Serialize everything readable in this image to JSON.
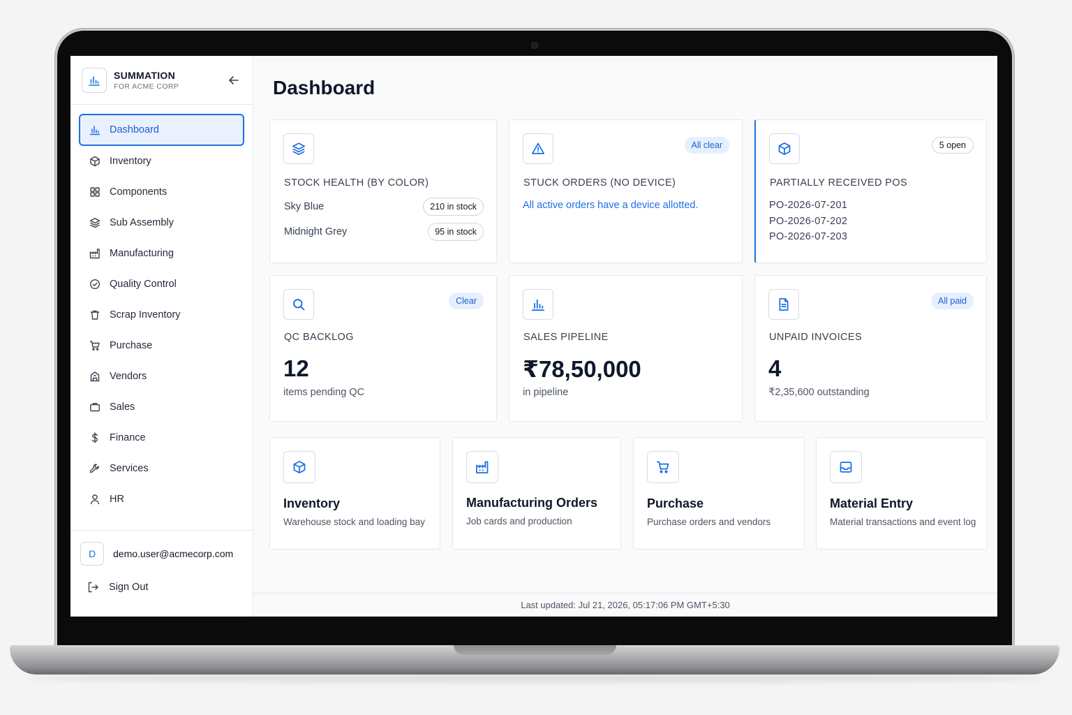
{
  "brand": {
    "name": "SUMMATION",
    "subtitle": "FOR ACME CORP"
  },
  "page_title": "Dashboard",
  "nav": [
    {
      "label": "Dashboard",
      "icon": "chart-icon",
      "active": true
    },
    {
      "label": "Inventory",
      "icon": "cube-icon"
    },
    {
      "label": "Components",
      "icon": "grid-icon"
    },
    {
      "label": "Sub Assembly",
      "icon": "layers-icon"
    },
    {
      "label": "Manufacturing",
      "icon": "factory-icon"
    },
    {
      "label": "Quality Control",
      "icon": "check-circle-icon"
    },
    {
      "label": "Scrap Inventory",
      "icon": "trash-icon"
    },
    {
      "label": "Purchase",
      "icon": "cart-icon"
    },
    {
      "label": "Vendors",
      "icon": "building-icon"
    },
    {
      "label": "Sales",
      "icon": "briefcase-icon"
    },
    {
      "label": "Finance",
      "icon": "dollar-icon"
    },
    {
      "label": "Services",
      "icon": "wrench-icon"
    },
    {
      "label": "HR",
      "icon": "user-icon"
    }
  ],
  "user": {
    "initial": "D",
    "email": "demo.user@acmecorp.com",
    "signout_label": "Sign Out"
  },
  "cards": {
    "stock_health": {
      "label": "STOCK HEALTH (BY COLOR)",
      "rows": [
        {
          "name": "Sky Blue",
          "stock": "210 in stock"
        },
        {
          "name": "Midnight Grey",
          "stock": "95 in stock"
        }
      ]
    },
    "stuck_orders": {
      "label": "STUCK ORDERS (NO DEVICE)",
      "badge": "All clear",
      "message": "All active orders have a device allotted."
    },
    "partial_pos": {
      "label": "PARTIALLY RECEIVED POS",
      "badge": "5 open",
      "items": [
        "PO-2026-07-201",
        "PO-2026-07-202",
        "PO-2026-07-203"
      ]
    },
    "qc_backlog": {
      "label": "QC BACKLOG",
      "badge": "Clear",
      "value": "12",
      "sub": "items pending QC"
    },
    "sales_pipeline": {
      "label": "SALES PIPELINE",
      "value": "₹78,50,000",
      "sub": "in pipeline"
    },
    "unpaid_invoices": {
      "label": "UNPAID INVOICES",
      "badge": "All paid",
      "value": "4",
      "sub": "₹2,35,600 outstanding"
    }
  },
  "quick_links": [
    {
      "title": "Inventory",
      "desc": "Warehouse stock and loading bay",
      "icon": "cube-icon"
    },
    {
      "title": "Manufacturing Orders",
      "desc": "Job cards and production",
      "icon": "factory-icon"
    },
    {
      "title": "Purchase",
      "desc": "Purchase orders and vendors",
      "icon": "cart-icon"
    },
    {
      "title": "Material Entry",
      "desc": "Material transactions and event log",
      "icon": "inbox-icon"
    }
  ],
  "footer": {
    "last_updated": "Last updated: Jul 21, 2026, 05:17:06 PM GMT+5:30"
  },
  "colors": {
    "accent": "#1d6fe5",
    "active_bg": "#e8f1fd",
    "badge_bg": "#e5effd"
  }
}
